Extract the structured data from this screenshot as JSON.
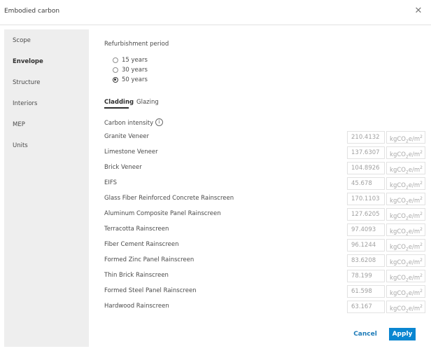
{
  "dialog": {
    "title": "Embodied carbon",
    "close_icon": "close-icon"
  },
  "sidebar": {
    "items": [
      {
        "label": "Scope",
        "active": false
      },
      {
        "label": "Envelope",
        "active": true
      },
      {
        "label": "Structure",
        "active": false
      },
      {
        "label": "Interiors",
        "active": false
      },
      {
        "label": "MEP",
        "active": false
      },
      {
        "label": "Units",
        "active": false
      }
    ]
  },
  "refurbishment": {
    "label": "Refurbishment period",
    "options": [
      {
        "label": "15 years",
        "checked": false
      },
      {
        "label": "30 years",
        "checked": false
      },
      {
        "label": "50 years",
        "checked": true
      }
    ]
  },
  "tabs": [
    {
      "label": "Cladding",
      "active": true
    },
    {
      "label": "Glazing",
      "active": false
    }
  ],
  "carbon_intensity": {
    "label": "Carbon intensity",
    "info_icon": "info-icon",
    "unit": {
      "prefix": "kgCO",
      "sub": "2",
      "mid": "e/m",
      "sup": "2"
    },
    "rows": [
      {
        "label": "Granite Veneer",
        "value": "210.4132"
      },
      {
        "label": "Limestone Veneer",
        "value": "137.6307"
      },
      {
        "label": "Brick Veneer",
        "value": "104.8926"
      },
      {
        "label": "EIFS",
        "value": "45.678"
      },
      {
        "label": "Glass Fiber Reinforced Concrete Rainscreen",
        "value": "170.1103"
      },
      {
        "label": "Aluminum Composite Panel Rainscreen",
        "value": "127.6205"
      },
      {
        "label": "Terracotta Rainscreen",
        "value": "97.4093"
      },
      {
        "label": "Fiber Cement Rainscreen",
        "value": "96.1244"
      },
      {
        "label": "Formed Zinc Panel Rainscreen",
        "value": "83.6208"
      },
      {
        "label": "Thin Brick Rainscreen",
        "value": "78.199"
      },
      {
        "label": "Formed Steel Panel Rainscreen",
        "value": "61.598"
      },
      {
        "label": "Hardwood Rainscreen",
        "value": "63.167"
      }
    ]
  },
  "footer": {
    "cancel_label": "Cancel",
    "apply_label": "Apply"
  },
  "colors": {
    "accent": "#0a86d1",
    "link": "#1d7bb8",
    "sidebar_bg": "#eeeeee"
  }
}
